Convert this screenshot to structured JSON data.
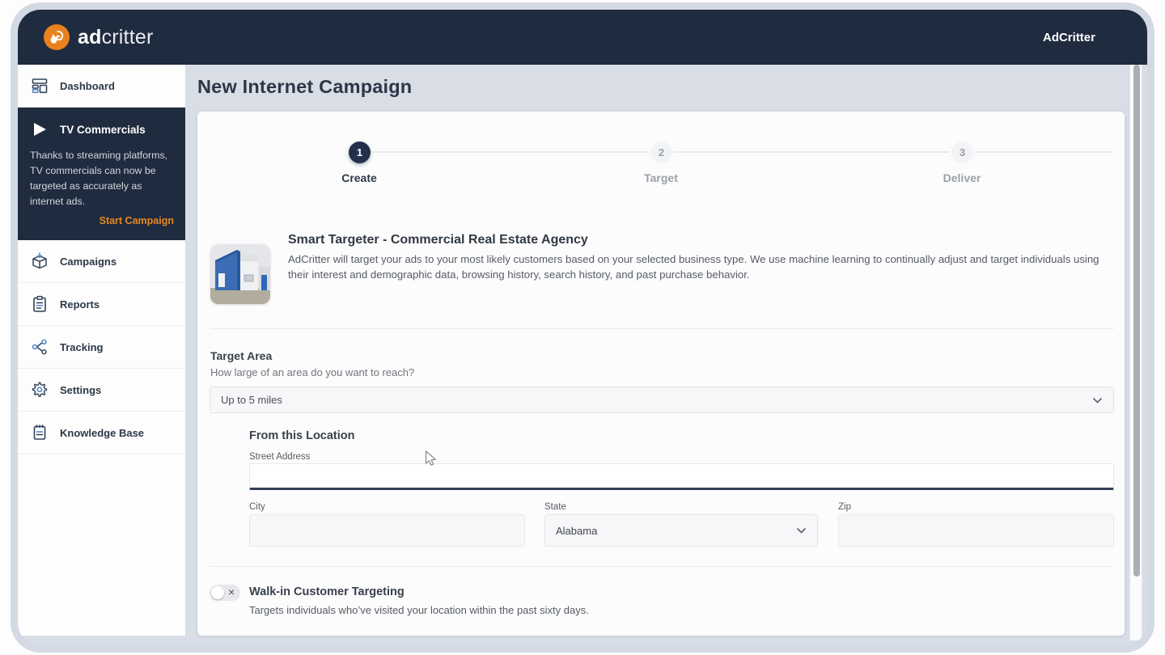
{
  "colors": {
    "navy": "#1f2b3e",
    "orange": "#e8821e",
    "main_bg": "#d8dde6",
    "window_frame": "#d3dae4",
    "active_step": "#22304a"
  },
  "topbar": {
    "logo_icon": "squirrel-icon",
    "logo_text_bold": "ad",
    "logo_text_light": "critter",
    "account_label": "AdCritter"
  },
  "sidebar": {
    "dashboard": {
      "icon": "dashboard-icon",
      "label": "Dashboard"
    },
    "tv_panel": {
      "icon": "play-icon",
      "title": "TV Commercials",
      "description": "Thanks to streaming platforms, TV commercials can now be targeted as accurately as internet ads.",
      "cta": "Start Campaign"
    },
    "items": [
      {
        "icon": "package-icon",
        "label": "Campaigns"
      },
      {
        "icon": "clipboard-icon",
        "label": "Reports"
      },
      {
        "icon": "share-nodes-icon",
        "label": "Tracking"
      },
      {
        "icon": "gear-icon",
        "label": "Settings"
      },
      {
        "icon": "notepad-icon",
        "label": "Knowledge Base"
      }
    ]
  },
  "main": {
    "page_title": "New Internet Campaign",
    "stepper": {
      "steps": [
        {
          "number": "1",
          "label": "Create",
          "state": "active"
        },
        {
          "number": "2",
          "label": "Target",
          "state": "inactive"
        },
        {
          "number": "3",
          "label": "Deliver",
          "state": "inactive"
        }
      ]
    },
    "product": {
      "image": "blue-commercial-building-photo",
      "title": "Smart Targeter - Commercial Real Estate Agency",
      "description": "AdCritter will target your ads to your most likely customers based on your selected business type. We use machine learning to continually adjust and target individuals using their interest and demographic data, browsing history, search history, and past purchase behavior."
    },
    "target_area": {
      "heading": "Target Area",
      "question": "How large of an area do you want to reach?",
      "selected_option": "Up to 5 miles"
    },
    "location_form": {
      "heading": "From this Location",
      "street": {
        "label": "Street Address",
        "value": ""
      },
      "city": {
        "label": "City",
        "value": ""
      },
      "state": {
        "label": "State",
        "value": "Alabama"
      },
      "zip": {
        "label": "Zip",
        "value": ""
      }
    },
    "walkin": {
      "heading": "Walk-in Customer Targeting",
      "description": "Targets individuals who’ve visited your location within the past sixty days.",
      "enabled": false
    }
  }
}
